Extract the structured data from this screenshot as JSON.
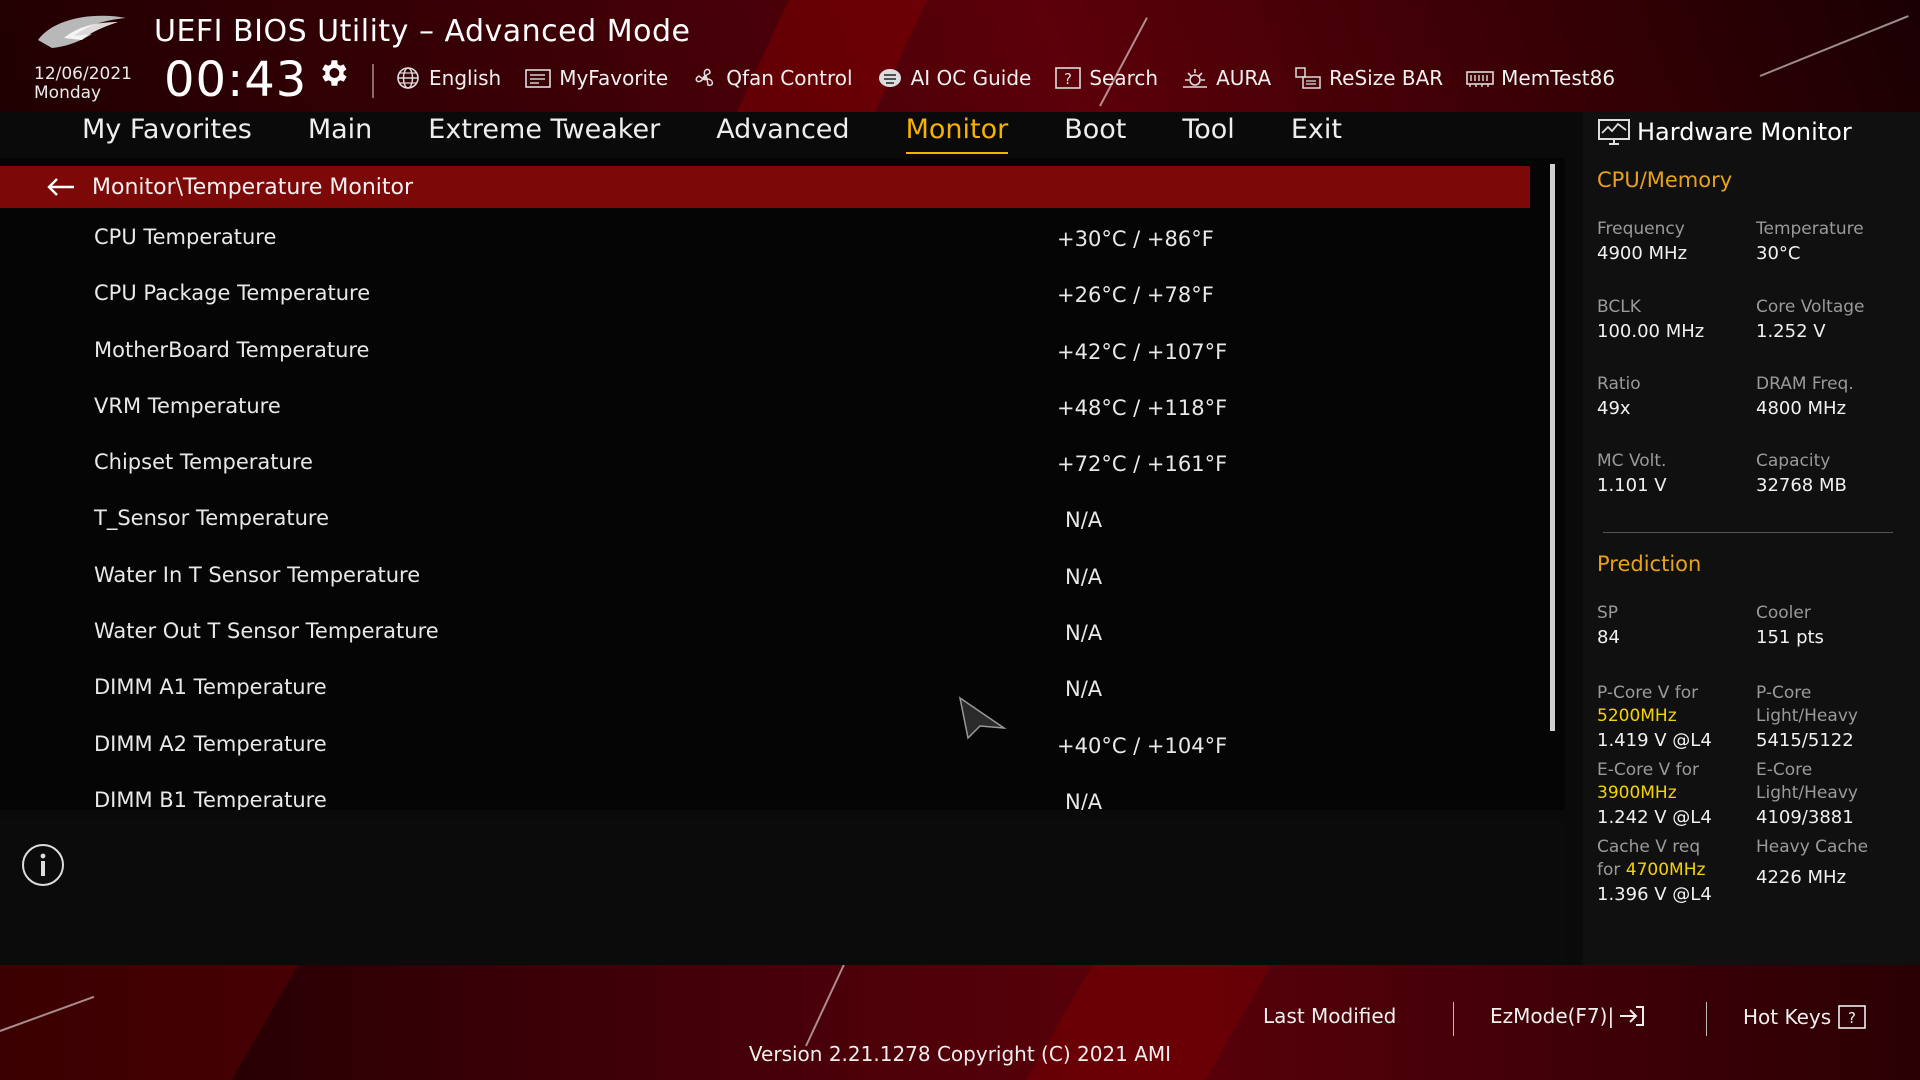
{
  "header": {
    "title": "UEFI BIOS Utility – Advanced Mode",
    "date": "12/06/2021",
    "weekday": "Monday",
    "time": "00:43"
  },
  "toolbar": [
    {
      "label": "English",
      "icon": "globe-icon"
    },
    {
      "label": "MyFavorite",
      "icon": "favorite-icon"
    },
    {
      "label": "Qfan Control",
      "icon": "fan-icon"
    },
    {
      "label": "AI OC Guide",
      "icon": "ai-oc-icon"
    },
    {
      "label": "Search",
      "icon": "search-icon"
    },
    {
      "label": "AURA",
      "icon": "aura-icon"
    },
    {
      "label": "ReSize BAR",
      "icon": "resize-bar-icon"
    },
    {
      "label": "MemTest86",
      "icon": "memtest-icon"
    }
  ],
  "nav": [
    {
      "label": "My Favorites"
    },
    {
      "label": "Main"
    },
    {
      "label": "Extreme Tweaker"
    },
    {
      "label": "Advanced"
    },
    {
      "label": "Monitor",
      "active": true
    },
    {
      "label": "Boot"
    },
    {
      "label": "Tool"
    },
    {
      "label": "Exit"
    }
  ],
  "breadcrumb": "Monitor\\Temperature Monitor",
  "rows": [
    {
      "label": "CPU Temperature",
      "value": "+30°C / +86°F"
    },
    {
      "label": "CPU Package Temperature",
      "value": "+26°C / +78°F"
    },
    {
      "label": "MotherBoard Temperature",
      "value": "+42°C / +107°F"
    },
    {
      "label": "VRM Temperature",
      "value": "+48°C / +118°F"
    },
    {
      "label": "Chipset Temperature",
      "value": "+72°C / +161°F"
    },
    {
      "label": "T_Sensor Temperature",
      "value": "N/A"
    },
    {
      "label": "Water In T Sensor Temperature",
      "value": "N/A"
    },
    {
      "label": "Water Out T Sensor Temperature",
      "value": "N/A"
    },
    {
      "label": "DIMM A1 Temperature",
      "value": "N/A"
    },
    {
      "label": "DIMM A2 Temperature",
      "value": "+40°C / +104°F"
    },
    {
      "label": "DIMM B1 Temperature",
      "value": "N/A"
    }
  ],
  "hw": {
    "title": "Hardware Monitor",
    "cpu_mem_title": "CPU/Memory",
    "prediction_title": "Prediction",
    "frequency_label": "Frequency",
    "frequency": "4900 MHz",
    "temperature_label": "Temperature",
    "temperature": "30°C",
    "bclk_label": "BCLK",
    "bclk": "100.00 MHz",
    "core_voltage_label": "Core Voltage",
    "core_voltage": "1.252 V",
    "ratio_label": "Ratio",
    "ratio": "49x",
    "dram_freq_label": "DRAM Freq.",
    "dram_freq": "4800 MHz",
    "mc_volt_label": "MC Volt.",
    "mc_volt": "1.101 V",
    "capacity_label": "Capacity",
    "capacity": "32768 MB",
    "sp_label": "SP",
    "sp": "84",
    "cooler_label": "Cooler",
    "cooler": "151 pts",
    "pcore_v_label": "P-Core V for",
    "pcore_v_freq": "5200MHz",
    "pcore_v": "1.419 V @L4",
    "pcore_lh_label1": "P-Core",
    "pcore_lh_label2": "Light/Heavy",
    "pcore_lh": "5415/5122",
    "ecore_v_label": "E-Core V for",
    "ecore_v_freq": "3900MHz",
    "ecore_v": "1.242 V @L4",
    "ecore_lh_label1": "E-Core",
    "ecore_lh_label2": "Light/Heavy",
    "ecore_lh": "4109/3881",
    "cache_v_label1": "Cache V req",
    "cache_v_label2": "for",
    "cache_v_freq": "4700MHz",
    "cache_v": "1.396 V @L4",
    "heavy_cache_label": "Heavy Cache",
    "heavy_cache": "4226 MHz"
  },
  "footer": {
    "last_modified": "Last Modified",
    "ezmode": "EzMode(F7)|",
    "hotkeys": "Hot Keys",
    "version": "Version 2.21.1278 Copyright (C) 2021 AMI"
  },
  "colors": {
    "accent": "#f7b200",
    "crumb_bg": "#7c0808",
    "section_title": "#e8a21a",
    "highlight": "#f5d400"
  }
}
